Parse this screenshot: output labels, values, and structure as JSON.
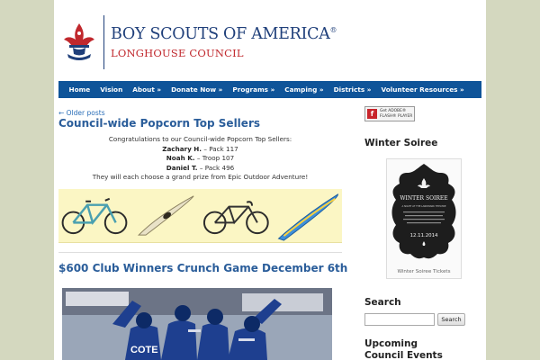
{
  "header": {
    "org_name": "BOY SCOUTS OF AMERICA",
    "org_mark": "®",
    "council_name": "LONGHOUSE COUNCIL"
  },
  "nav": {
    "items": [
      {
        "label": "Home"
      },
      {
        "label": "Vision"
      },
      {
        "label": "About »"
      },
      {
        "label": "Donate Now »"
      },
      {
        "label": "Programs »"
      },
      {
        "label": "Camping »"
      },
      {
        "label": "Districts »"
      },
      {
        "label": "Volunteer Resources »"
      }
    ]
  },
  "main": {
    "older_posts": "← Older posts",
    "post1": {
      "title": "Council-wide Popcorn Top Sellers",
      "intro": "Congratulations to our Council-wide Popcorn Top Sellers:",
      "sellers": [
        {
          "name": "Zachary H.",
          "unit": " – Pack 117"
        },
        {
          "name": "Noah K.",
          "unit": " – Troop 107"
        },
        {
          "name": "Daniel T.",
          "unit": " – Pack 496"
        }
      ],
      "outro": "They will each choose a grand prize from Epic Outdoor Adventure!"
    },
    "post2": {
      "title": "$600 Club Winners Crunch Game December 6th",
      "jersey_text": "COTE"
    }
  },
  "sidebar": {
    "flash": {
      "line1": "Get ADOBE®",
      "line2": "FLASH® PLAYER"
    },
    "soiree": {
      "title": "Winter Soiree",
      "poster_title": "WINTER SOIREE",
      "poster_sub": "A NIGHT AT THE LANDMARK THEATRE",
      "poster_date": "12.11.2014",
      "caption": "Winter Soiree Tickets"
    },
    "search": {
      "title": "Search",
      "placeholder": "",
      "button_label": "Search"
    },
    "events": {
      "title": "Upcoming Council Events"
    }
  },
  "colors": {
    "nav_bg": "#0f5499",
    "heading_blue": "#2a5d9a",
    "brand_navy": "#1f3f7a",
    "brand_red": "#c0282d",
    "page_bg": "#d4d8bf"
  }
}
